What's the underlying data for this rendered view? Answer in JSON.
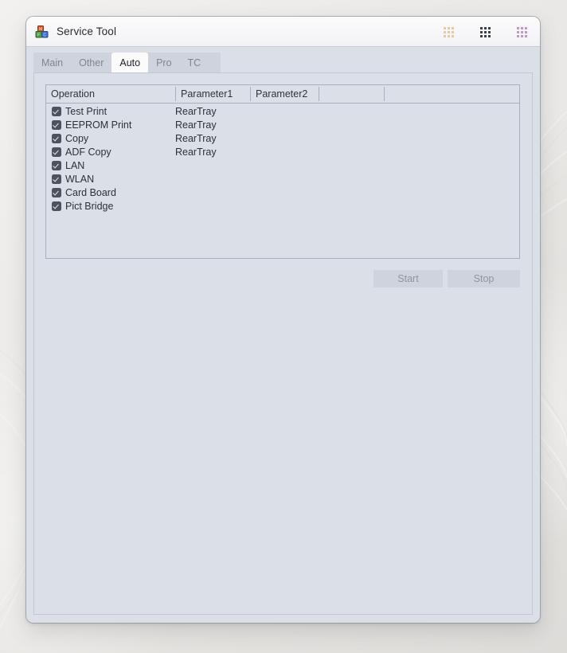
{
  "window": {
    "title": "Service Tool",
    "icon": "toy-blocks-icon",
    "controls": [
      {
        "name": "minimize-button",
        "icon": "minimize-dots-icon",
        "color": "#e9c9a0"
      },
      {
        "name": "maximize-button",
        "icon": "maximize-dots-icon",
        "color": "#3b3f46"
      },
      {
        "name": "close-button",
        "icon": "close-dots-icon",
        "color": "#c09ac4"
      }
    ]
  },
  "tabs": [
    {
      "label": "Main",
      "active": false
    },
    {
      "label": "Other",
      "active": false
    },
    {
      "label": "Auto",
      "active": true
    },
    {
      "label": "Pro",
      "active": false
    },
    {
      "label": "TC",
      "active": false
    }
  ],
  "table": {
    "columns": [
      "Operation",
      "Parameter1",
      "Parameter2",
      "",
      ""
    ],
    "rows": [
      {
        "checked": true,
        "operation": "Test Print",
        "parameter1": "RearTray",
        "parameter2": ""
      },
      {
        "checked": true,
        "operation": "EEPROM Print",
        "parameter1": "RearTray",
        "parameter2": ""
      },
      {
        "checked": true,
        "operation": "Copy",
        "parameter1": "RearTray",
        "parameter2": ""
      },
      {
        "checked": true,
        "operation": "ADF Copy",
        "parameter1": "RearTray",
        "parameter2": ""
      },
      {
        "checked": true,
        "operation": "LAN",
        "parameter1": "",
        "parameter2": ""
      },
      {
        "checked": true,
        "operation": "WLAN",
        "parameter1": "",
        "parameter2": ""
      },
      {
        "checked": true,
        "operation": "Card Board",
        "parameter1": "",
        "parameter2": ""
      },
      {
        "checked": true,
        "operation": "Pict Bridge",
        "parameter1": "",
        "parameter2": ""
      }
    ]
  },
  "actions": {
    "start_label": "Start",
    "stop_label": "Stop",
    "start_enabled": false,
    "stop_enabled": false
  },
  "colors": {
    "window_bg": "#dbdfe8",
    "titlebar_bg": "#f7f7f9",
    "tabstrip_bg": "#ced3dd",
    "active_tab_bg": "#fbfbfc",
    "border": "#a9afbb",
    "checkbox": "#4c5260",
    "disabled_text": "#9096a1",
    "text": "#2c3037"
  }
}
